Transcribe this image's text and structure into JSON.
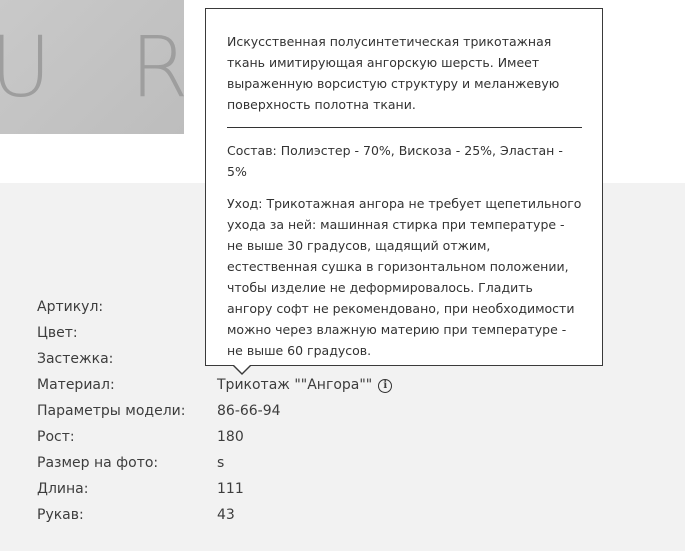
{
  "product_photo": {
    "watermark_text": "U R"
  },
  "specs": [
    {
      "label": "Артикул:",
      "value": ""
    },
    {
      "label": "Цвет:",
      "value": ""
    },
    {
      "label": "Застежка:",
      "value": ""
    },
    {
      "label": "Материал:",
      "value": "Трикотаж \"\"Ангора\"\"",
      "info_icon": "info-icon"
    },
    {
      "label": "Параметры модели:",
      "value": "86-66-94"
    },
    {
      "label": "Рост:",
      "value": "180"
    },
    {
      "label": "Размер на фото:",
      "value": "s"
    },
    {
      "label": "Длина:",
      "value": "111"
    },
    {
      "label": "Рукав:",
      "value": "43"
    }
  ],
  "tooltip": {
    "description": "Искусственная полусинтетическая трикотажная ткань имитирующая ангорскую шерсть. Имеет выраженную ворсистую структуру и меланжевую поверхность полотна ткани.",
    "composition": "Состав: Полиэстер - 70%, Вискоза - 25%, Эластан - 5%",
    "care": "Уход:  Трикотажная ангора не требует щепетильного ухода за ней: машинная стирка при температуре - не выше 30 градусов, щадящий отжим, естественная сушка в горизонтальном положении, чтобы изделие не деформировалось. Гладить ангору софт не рекомендовано, при необходимости можно через влажную материю при температуре - не выше 60 градусов."
  }
}
